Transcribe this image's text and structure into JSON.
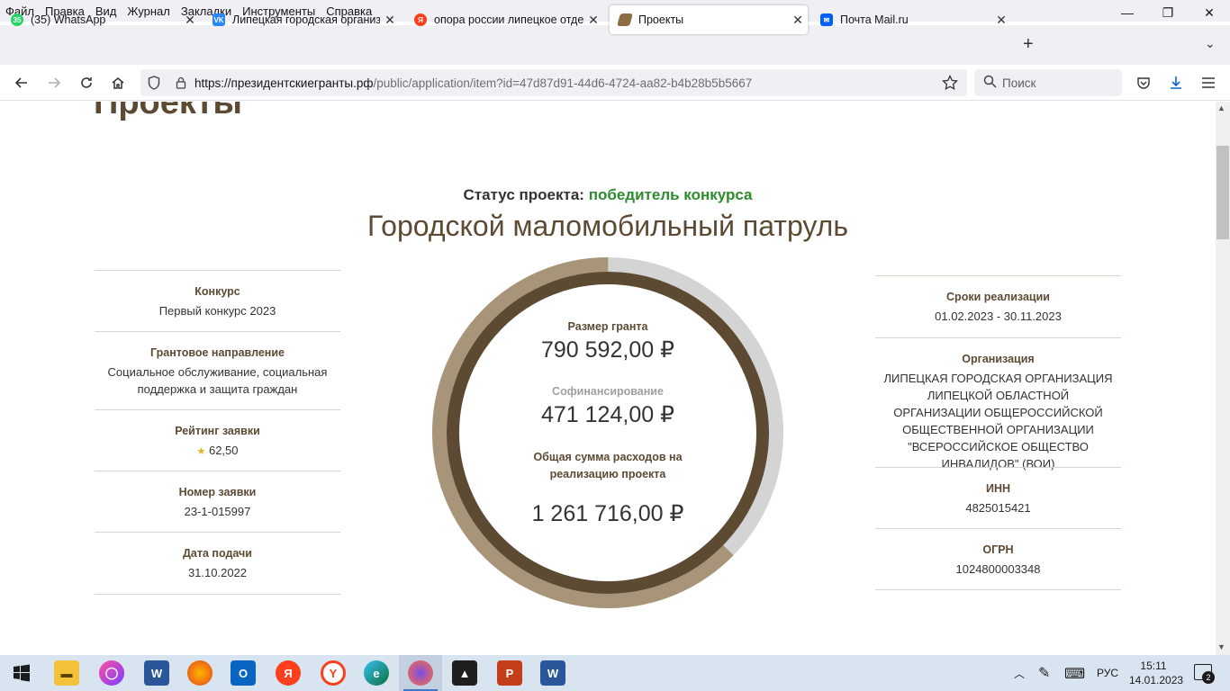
{
  "menu": [
    "Файл",
    "Правка",
    "Вид",
    "Журнал",
    "Закладки",
    "Инструменты",
    "Справка"
  ],
  "window_controls": {
    "minimize": "—",
    "restore": "❐",
    "close": "✕"
  },
  "tabs": [
    {
      "title": "(35) WhatsApp",
      "badge": "35",
      "color": "#25d366"
    },
    {
      "title": "Липецкая городская организаци",
      "badge": "VK",
      "color": "#2787f5"
    },
    {
      "title": "опора россии липецкое отдел",
      "badge": "Я",
      "color": "#fc3f1d"
    },
    {
      "title": "Проекты",
      "badge": "",
      "color": "#8a6d45"
    },
    {
      "title": "Почта Mail.ru",
      "badge": "✉",
      "color": "#005ff9"
    }
  ],
  "newtab_label": "+",
  "tablist_label": "⌄",
  "url": {
    "host": "https://президентскиегранты.рф",
    "rest": "/public/application/item?id=47d87d91-44d6-4724-aa82-b4b28b5b5667"
  },
  "search_placeholder": "Поиск",
  "page": {
    "heading": "Проекты",
    "status_label": "Статус проекта:",
    "status_value": "победитель конкурса",
    "title": "Городской маломобильный патруль",
    "left": [
      {
        "label": "Конкурс",
        "value": "Первый конкурс 2023"
      },
      {
        "label": "Грантовое направление",
        "value": "Социальное обслуживание, социальная поддержка и защита граждан"
      },
      {
        "label": "Рейтинг заявки",
        "value": "62,50"
      },
      {
        "label": "Номер заявки",
        "value": "23-1-015997"
      },
      {
        "label": "Дата подачи",
        "value": "31.10.2022"
      }
    ],
    "right": [
      {
        "label": "Сроки реализации",
        "value": "01.02.2023 - 30.11.2023"
      },
      {
        "label": "Организация",
        "value": "ЛИПЕЦКАЯ ГОРОДСКАЯ ОРГАНИЗАЦИЯ ЛИПЕЦКОЙ ОБЛАСТНОЙ ОРГАНИЗАЦИИ ОБЩЕРОССИЙСКОЙ ОБЩЕСТВЕННОЙ ОРГАНИЗАЦИИ \"ВСЕРОССИЙСКОЕ ОБЩЕСТВО ИНВАЛИДОВ\" (ВОИ)"
      },
      {
        "label": "ИНН",
        "value": "4825015421"
      },
      {
        "label": "ОГРН",
        "value": "1024800003348"
      }
    ],
    "grant_label": "Размер гранта",
    "grant_value": "790 592,00 ₽",
    "cofin_label": "Софинансирование",
    "cofin_value": "471 124,00 ₽",
    "total_label": "Общая сумма расходов на реализацию проекта",
    "total_value": "1 261 716,00 ₽",
    "ring_fraction": 0.627,
    "colors": {
      "ring_dark": "#5c4a33",
      "ring_light": "#a89579",
      "ring_gray": "#d4d4d4",
      "status_green": "#2e8b2e"
    }
  },
  "taskbar": {
    "lang": "РУС",
    "time": "15:11",
    "date": "14.01.2023",
    "notifications": "2",
    "apps": [
      "start-icon",
      "explorer-icon",
      "app-icon",
      "word-icon",
      "firefox-icon",
      "outlook-icon",
      "yandex-icon",
      "yandex-browser-icon",
      "edge-icon",
      "firefox-active-icon",
      "photos-icon",
      "powerpoint-icon",
      "word-icon-2"
    ]
  }
}
